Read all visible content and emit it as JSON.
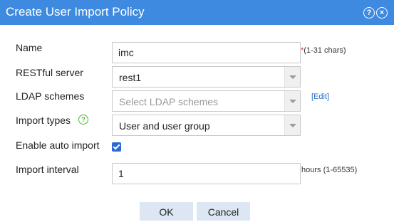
{
  "dialog": {
    "title": "Create User Import Policy"
  },
  "icons": {
    "help": "help-circle-icon",
    "close": "close-circle-icon"
  },
  "form": {
    "name": {
      "label": "Name",
      "value": "imc",
      "required_mark": "*",
      "hint": "(1-31 chars)"
    },
    "restful_server": {
      "label": "RESTful server",
      "value": "rest1"
    },
    "ldap_schemes": {
      "label": "LDAP schemes",
      "placeholder": "Select LDAP schemes",
      "edit_link": "[Edit]"
    },
    "import_types": {
      "label": "Import types",
      "value": "User and user group"
    },
    "auto_import": {
      "label": "Enable auto import",
      "checked": true
    },
    "import_interval": {
      "label": "Import interval",
      "value": "1",
      "hint": "hours (1-65535)"
    }
  },
  "buttons": {
    "ok": "OK",
    "cancel": "Cancel"
  },
  "colors": {
    "titlebar": "#3e8ae0",
    "accent": "#2b6ad2",
    "help_green": "#4eb53b",
    "button_bg": "#dde7f3"
  }
}
